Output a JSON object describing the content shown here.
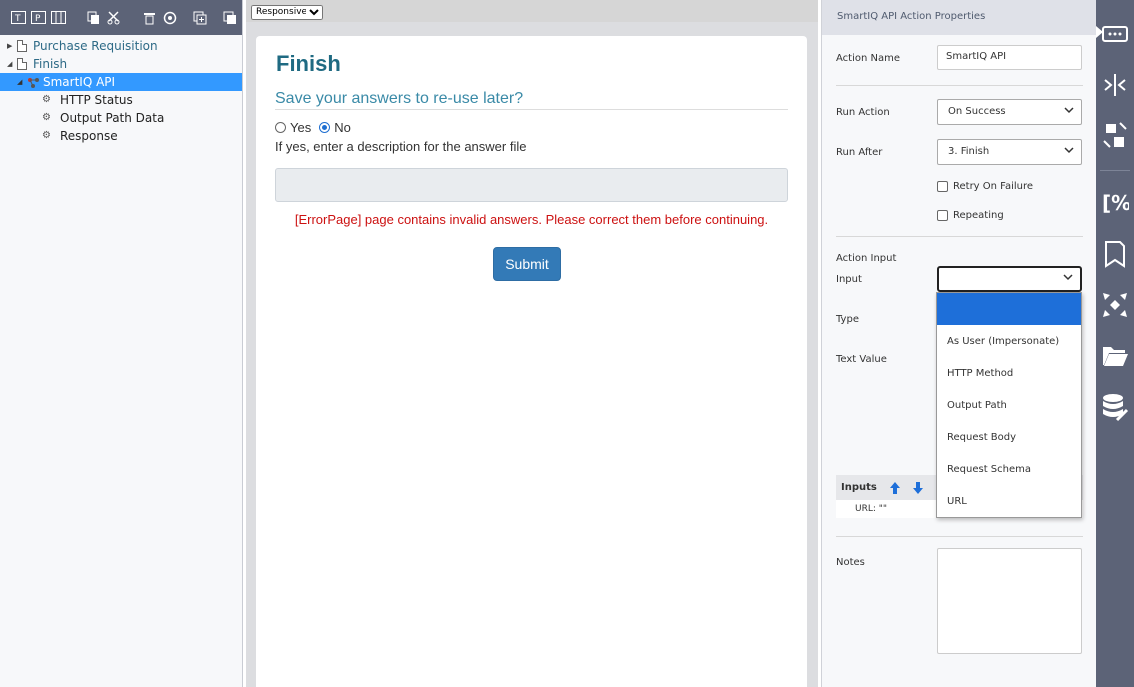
{
  "left_toolbar": {
    "icons": [
      "text-field-icon",
      "page-icon",
      "columns-icon",
      "copy-icon",
      "cut-icon",
      "delete-icon",
      "settings-icon",
      "add-page-icon",
      "add-section-icon"
    ]
  },
  "tree": {
    "items": [
      {
        "label": "Purchase Requisition"
      },
      {
        "label": "Finish"
      },
      {
        "label": "SmartIQ API"
      },
      {
        "label": "HTTP Status"
      },
      {
        "label": "Output Path Data"
      },
      {
        "label": "Response"
      }
    ]
  },
  "center": {
    "layout_select": "Responsive",
    "title": "Finish",
    "question": "Save your answers to re-use later?",
    "radio_yes": "Yes",
    "radio_no": "No",
    "selected": "No",
    "hint": "If yes, enter a description for the answer file",
    "answer_value": "",
    "error": "[ErrorPage] page contains invalid answers. Please correct them before continuing.",
    "submit": "Submit"
  },
  "props": {
    "header": "SmartIQ API Action Properties",
    "action_name_label": "Action Name",
    "action_name_value": "SmartIQ API",
    "run_action_label": "Run Action",
    "run_action_value": "On Success",
    "run_after_label": "Run After",
    "run_after_value": "3. Finish",
    "retry_label": "Retry On Failure",
    "repeating_label": "Repeating",
    "action_input_label": "Action Input",
    "input_label": "Input",
    "input_value": "",
    "type_label": "Type",
    "text_value_label": "Text Value",
    "inputs_header": "Inputs",
    "inputs_row": "URL: \"\"",
    "notes_label": "Notes",
    "notes_value": ""
  },
  "dropdown": {
    "options": [
      "",
      "As User (Impersonate)",
      "HTTP Method",
      "Output Path",
      "Request Body",
      "Request Schema",
      "URL"
    ]
  },
  "icon_bar": {
    "icons": [
      "action-properties-icon",
      "merge-icon",
      "split-icon",
      "percent-icon",
      "bookmark-icon",
      "expand-icon",
      "folder-icon",
      "database-icon"
    ]
  },
  "colors": {
    "toolbar": "#5c6377",
    "tree_selected": "#3399ff",
    "title": "#1f6a82",
    "error": "#cc1111",
    "submit": "#337ab7",
    "dropdown_active": "#1e6fd9"
  }
}
